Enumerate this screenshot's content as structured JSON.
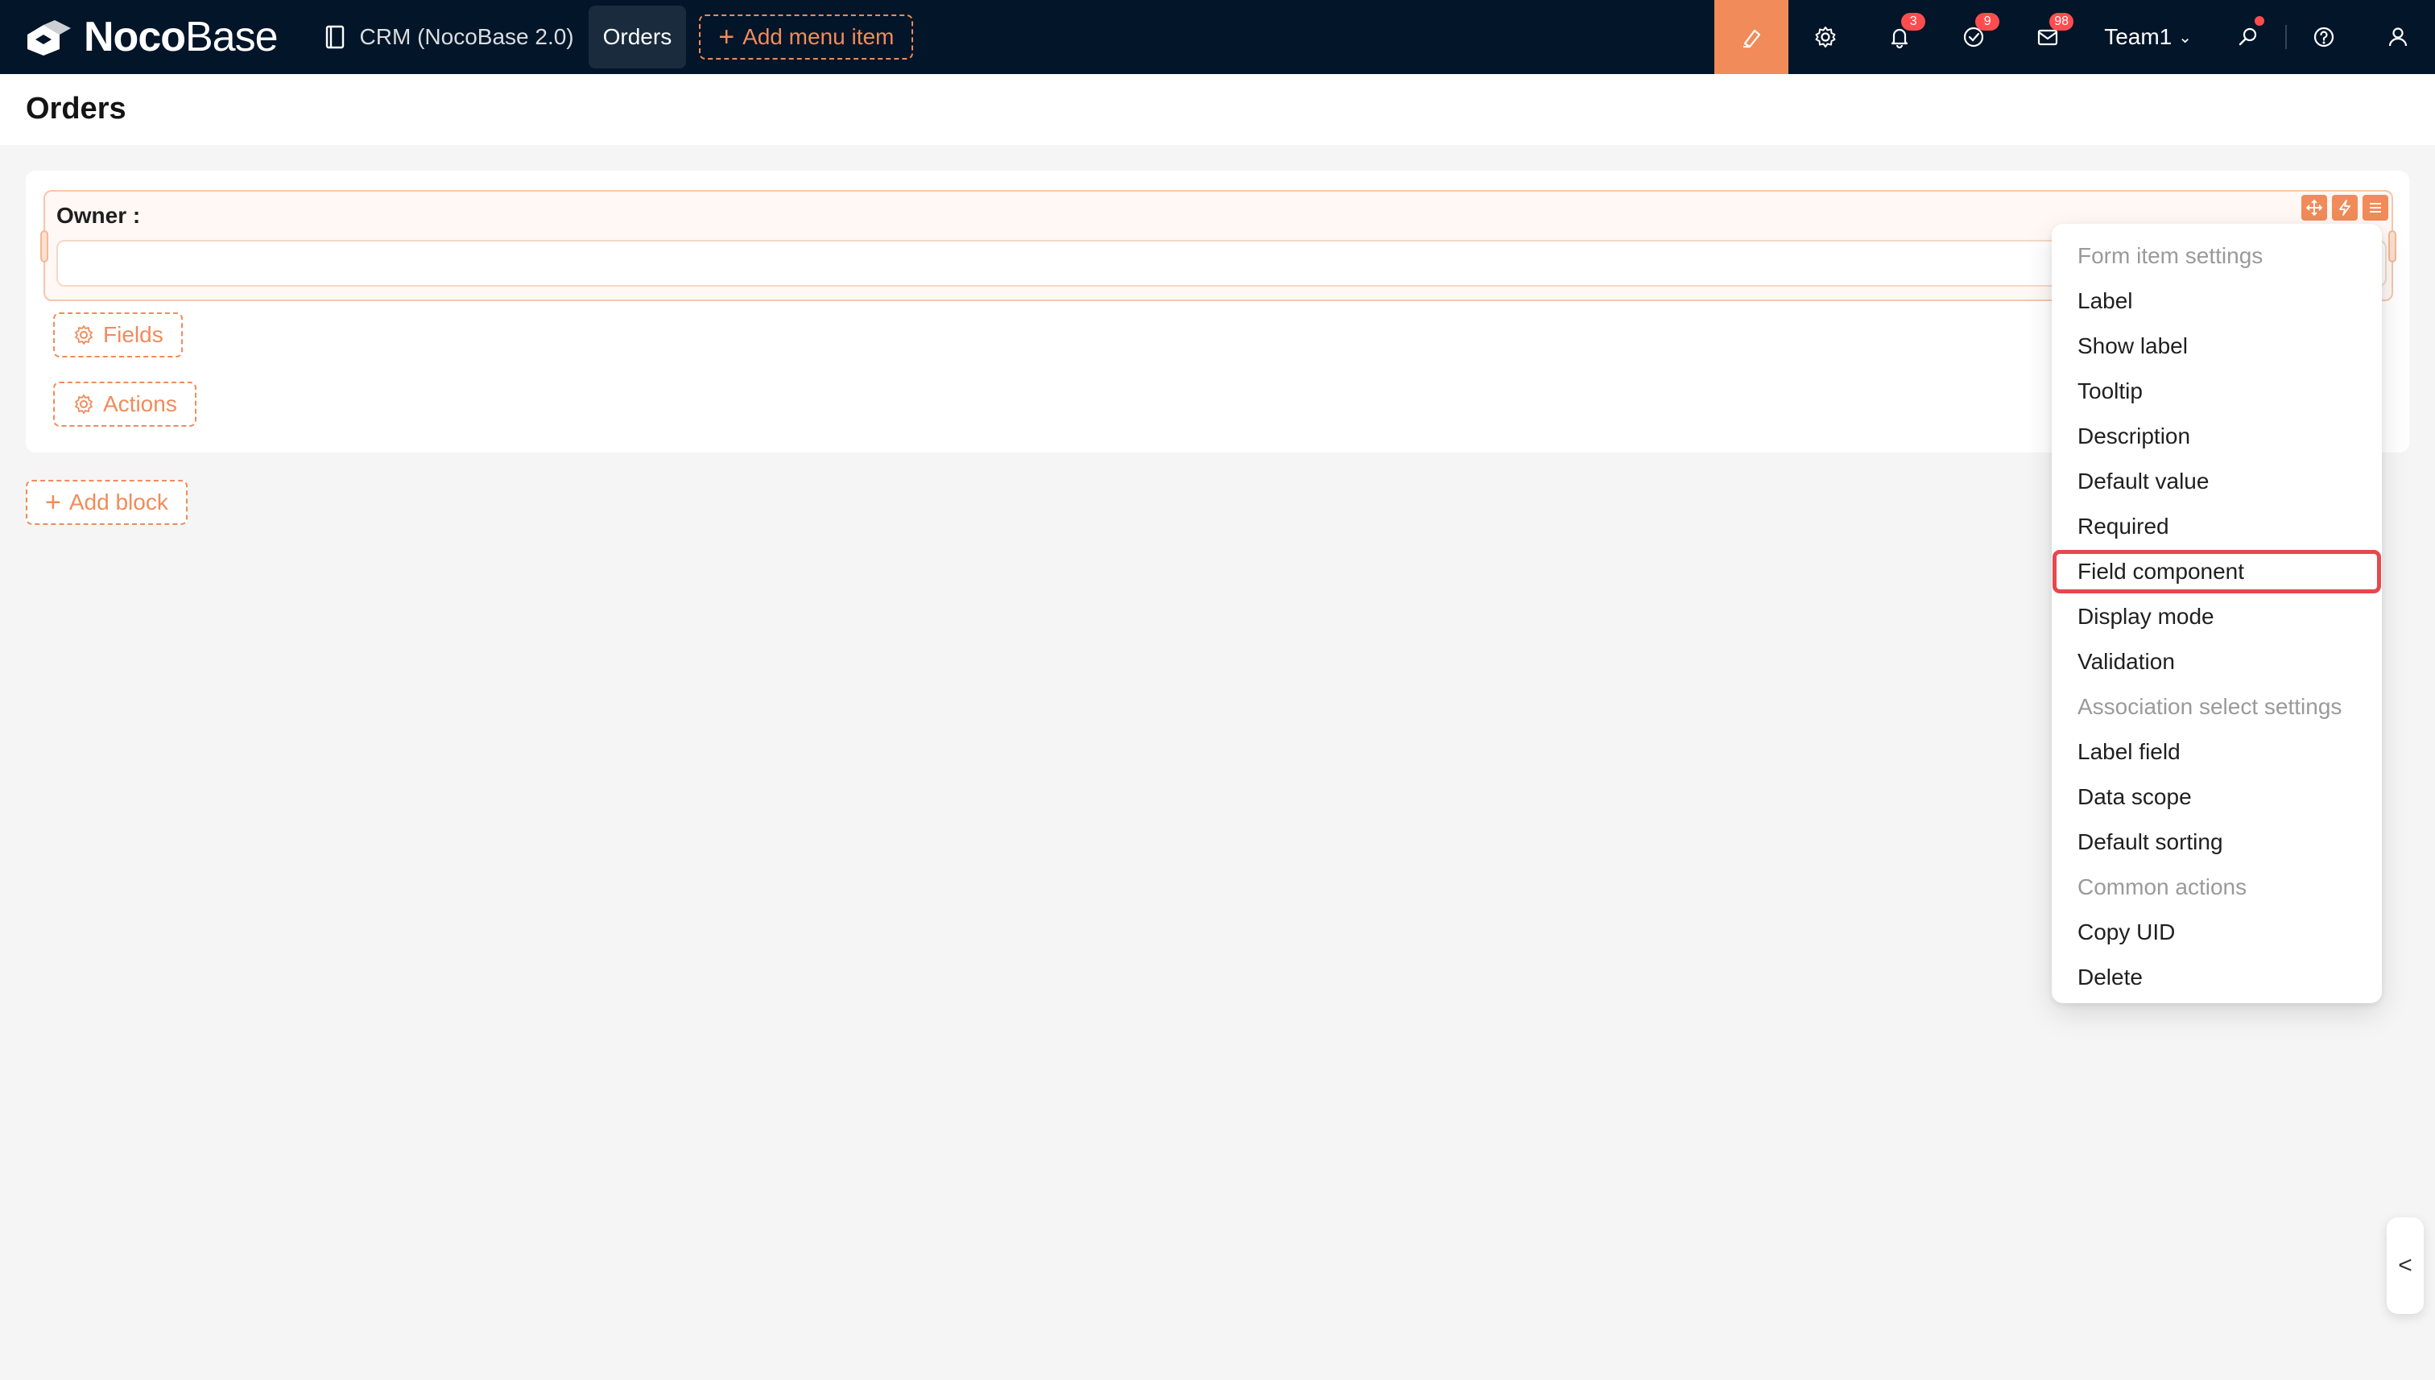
{
  "header": {
    "logo": {
      "bold": "Noco",
      "light": "Base"
    },
    "nav": {
      "crm_label": "CRM (NocoBase 2.0)",
      "orders_label": "Orders",
      "add_menu_label": "Add menu item"
    },
    "badges": {
      "notifications": "3",
      "tasks": "9",
      "messages": "98"
    },
    "team_label": "Team1",
    "accent_color": "#f18b5a",
    "background_color": "#031529"
  },
  "page": {
    "title": "Orders"
  },
  "form": {
    "field_label": "Owner :",
    "fields_button": "Fields",
    "actions_button": "Actions"
  },
  "add_block_label": "Add block",
  "menu": {
    "groups": {
      "form_item_settings": "Form item settings",
      "association_select_settings": "Association select settings",
      "common_actions": "Common actions"
    },
    "items": {
      "label": "Label",
      "show_label": "Show label",
      "tooltip": "Tooltip",
      "description": "Description",
      "default_value": "Default value",
      "required": "Required",
      "field_component": "Field component",
      "display_mode": "Display mode",
      "validation": "Validation",
      "label_field": "Label field",
      "data_scope": "Data scope",
      "default_sorting": "Default sorting",
      "copy_uid": "Copy UID",
      "delete": "Delete"
    },
    "highlight_color": "#e5484d"
  },
  "side_tab_glyph": "<"
}
